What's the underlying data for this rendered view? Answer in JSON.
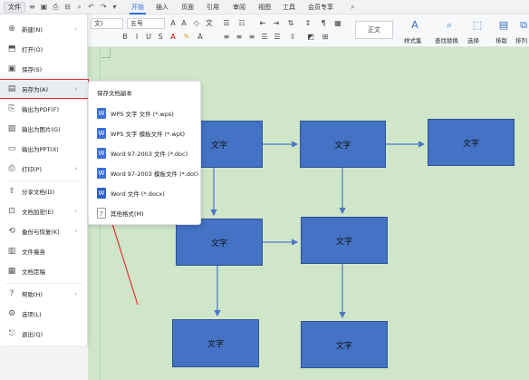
{
  "topbar": {
    "file_label": "文件",
    "tabs": [
      "开始",
      "插入",
      "页面",
      "引用",
      "审阅",
      "视图",
      "工具",
      "会员专享"
    ]
  },
  "ribbon": {
    "font_value": "文)",
    "size_value": "五号",
    "style_value": "正文",
    "labels": [
      "样式集",
      "查找替换",
      "选择",
      "排版",
      "排列"
    ]
  },
  "file_menu": {
    "items": [
      {
        "label": "新建(N)",
        "icon": "new-icon",
        "has_submenu": true
      },
      {
        "label": "打开(O)",
        "icon": "open-icon",
        "has_submenu": false
      },
      {
        "label": "保存(S)",
        "icon": "save-icon",
        "has_submenu": false
      },
      {
        "label": "另存为(A)",
        "icon": "save-as-icon",
        "has_submenu": true
      },
      {
        "label": "输出为PDF(F)",
        "icon": "pdf-icon",
        "has_submenu": false
      },
      {
        "label": "输出为图片(G)",
        "icon": "image-icon",
        "has_submenu": false
      },
      {
        "label": "输出为PPT(X)",
        "icon": "ppt-icon",
        "has_submenu": false
      },
      {
        "label": "打印(P)",
        "icon": "print-icon",
        "has_submenu": true
      },
      {
        "label": "分享文档(D)",
        "icon": "share-icon",
        "has_submenu": false
      },
      {
        "label": "文档加密(E)",
        "icon": "lock-icon",
        "has_submenu": true
      },
      {
        "label": "备份与恢复(K)",
        "icon": "backup-icon",
        "has_submenu": true
      },
      {
        "label": "文件瘦身",
        "icon": "slim-icon",
        "has_submenu": false
      },
      {
        "label": "文档定稿",
        "icon": "finalize-icon",
        "has_submenu": false
      },
      {
        "label": "帮助(H)",
        "icon": "help-icon",
        "has_submenu": true
      },
      {
        "label": "选项(L)",
        "icon": "options-icon",
        "has_submenu": false
      },
      {
        "label": "退出(Q)",
        "icon": "exit-icon",
        "has_submenu": false
      }
    ]
  },
  "submenu": {
    "title": "保存文档副本",
    "items": [
      {
        "label": "WPS 文字 文件 (*.wps)",
        "icon": "wps-doc-icon"
      },
      {
        "label": "WPS 文字 模板文件 (*.wpt)",
        "icon": "wps-template-icon"
      },
      {
        "label": "Word 97-2003 文件 (*.doc)",
        "icon": "word-doc-icon"
      },
      {
        "label": "Word 97-2003 模板文件 (*.dot)",
        "icon": "word-template-icon"
      },
      {
        "label": "Word 文件 (*.docx)",
        "icon": "word-docx-icon"
      },
      {
        "label": "其他格式(M)",
        "icon": "other-format-icon"
      }
    ]
  },
  "flowchart": {
    "boxes": [
      "文字",
      "文字",
      "文字",
      "文字",
      "文字",
      "文字",
      "文字"
    ]
  },
  "colors": {
    "accent": "#2a6fdb",
    "box_fill": "#4472c4",
    "canvas": "#cfe6c9",
    "annotation": "#e0302f"
  }
}
